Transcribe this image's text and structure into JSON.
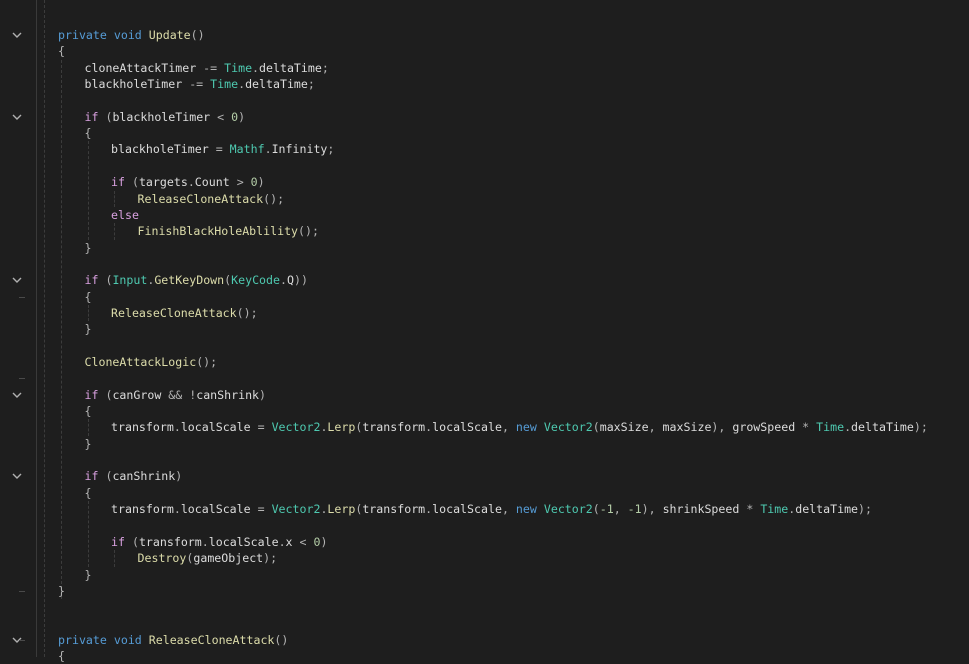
{
  "editor": {
    "theme": {
      "background": "#1e1e1e",
      "keyword": "#569cd6",
      "control_keyword": "#d8a0df",
      "type": "#4ec9b0",
      "method": "#dcdcaa",
      "identifier": "#dcdcdc",
      "number": "#b5cea8"
    },
    "fold_icon": "chevron-down-icon",
    "lines": [
      {
        "t": [
          [
            "kw",
            "private"
          ],
          [
            "id",
            " "
          ],
          [
            "kw",
            "void"
          ],
          [
            "id",
            " "
          ],
          [
            "mth",
            "Update"
          ],
          [
            "pn",
            "()"
          ]
        ]
      },
      {
        "t": [
          [
            "pn",
            "{"
          ]
        ]
      },
      {
        "t": [
          [
            "id",
            "cloneAttackTimer "
          ],
          [
            "pn",
            "-="
          ],
          [
            "id",
            " "
          ],
          [
            "typ",
            "Time"
          ],
          [
            "pn",
            "."
          ],
          [
            "id",
            "deltaTime"
          ],
          [
            "pn",
            ";"
          ]
        ]
      },
      {
        "t": [
          [
            "id",
            "blackholeTimer "
          ],
          [
            "pn",
            "-="
          ],
          [
            "id",
            " "
          ],
          [
            "typ",
            "Time"
          ],
          [
            "pn",
            "."
          ],
          [
            "id",
            "deltaTime"
          ],
          [
            "pn",
            ";"
          ]
        ]
      },
      {
        "t": []
      },
      {
        "t": [
          [
            "ctl",
            "if"
          ],
          [
            "id",
            " "
          ],
          [
            "pn",
            "("
          ],
          [
            "id",
            "blackholeTimer "
          ],
          [
            "pn",
            "<"
          ],
          [
            "id",
            " "
          ],
          [
            "num",
            "0"
          ],
          [
            "pn",
            ")"
          ]
        ]
      },
      {
        "t": [
          [
            "pn",
            "{"
          ]
        ]
      },
      {
        "t": [
          [
            "id",
            "blackholeTimer "
          ],
          [
            "pn",
            "="
          ],
          [
            "id",
            " "
          ],
          [
            "typ",
            "Mathf"
          ],
          [
            "pn",
            "."
          ],
          [
            "id",
            "Infinity"
          ],
          [
            "pn",
            ";"
          ]
        ]
      },
      {
        "t": []
      },
      {
        "t": [
          [
            "ctl",
            "if"
          ],
          [
            "id",
            " "
          ],
          [
            "pn",
            "("
          ],
          [
            "id",
            "targets"
          ],
          [
            "pn",
            "."
          ],
          [
            "id",
            "Count "
          ],
          [
            "pn",
            ">"
          ],
          [
            "id",
            " "
          ],
          [
            "num",
            "0"
          ],
          [
            "pn",
            ")"
          ]
        ]
      },
      {
        "t": [
          [
            "mth",
            "ReleaseCloneAttack"
          ],
          [
            "pn",
            "();"
          ]
        ]
      },
      {
        "t": [
          [
            "ctl",
            "else"
          ]
        ]
      },
      {
        "t": [
          [
            "mth",
            "FinishBlackHoleAblility"
          ],
          [
            "pn",
            "();"
          ]
        ]
      },
      {
        "t": [
          [
            "pn",
            "}"
          ]
        ]
      },
      {
        "t": []
      },
      {
        "t": [
          [
            "ctl",
            "if"
          ],
          [
            "id",
            " "
          ],
          [
            "pn",
            "("
          ],
          [
            "typ",
            "Input"
          ],
          [
            "pn",
            "."
          ],
          [
            "mth",
            "GetKeyDown"
          ],
          [
            "pn",
            "("
          ],
          [
            "typ",
            "KeyCode"
          ],
          [
            "pn",
            "."
          ],
          [
            "id",
            "Q"
          ],
          [
            "pn",
            "))"
          ]
        ]
      },
      {
        "t": [
          [
            "pn",
            "{"
          ]
        ]
      },
      {
        "t": [
          [
            "mth",
            "ReleaseCloneAttack"
          ],
          [
            "pn",
            "();"
          ]
        ]
      },
      {
        "t": [
          [
            "pn",
            "}"
          ]
        ]
      },
      {
        "t": []
      },
      {
        "t": [
          [
            "mth",
            "CloneAttackLogic"
          ],
          [
            "pn",
            "();"
          ]
        ]
      },
      {
        "t": []
      },
      {
        "t": [
          [
            "ctl",
            "if"
          ],
          [
            "id",
            " "
          ],
          [
            "pn",
            "("
          ],
          [
            "id",
            "canGrow "
          ],
          [
            "pn",
            "&&"
          ],
          [
            "id",
            " "
          ],
          [
            "pn",
            "!"
          ],
          [
            "id",
            "canShrink"
          ],
          [
            "pn",
            ")"
          ]
        ]
      },
      {
        "t": [
          [
            "pn",
            "{"
          ]
        ]
      },
      {
        "t": [
          [
            "id",
            "transform"
          ],
          [
            "pn",
            "."
          ],
          [
            "id",
            "localScale "
          ],
          [
            "pn",
            "="
          ],
          [
            "id",
            " "
          ],
          [
            "typ",
            "Vector2"
          ],
          [
            "pn",
            "."
          ],
          [
            "mth",
            "Lerp"
          ],
          [
            "pn",
            "("
          ],
          [
            "id",
            "transform"
          ],
          [
            "pn",
            "."
          ],
          [
            "id",
            "localScale"
          ],
          [
            "pn",
            ","
          ],
          [
            "id",
            " "
          ],
          [
            "kw",
            "new"
          ],
          [
            "id",
            " "
          ],
          [
            "typ",
            "Vector2"
          ],
          [
            "pn",
            "("
          ],
          [
            "id",
            "maxSize"
          ],
          [
            "pn",
            ","
          ],
          [
            "id",
            " maxSize"
          ],
          [
            "pn",
            "),"
          ],
          [
            "id",
            " growSpeed "
          ],
          [
            "pn",
            "*"
          ],
          [
            "id",
            " "
          ],
          [
            "typ",
            "Time"
          ],
          [
            "pn",
            "."
          ],
          [
            "id",
            "deltaTime"
          ],
          [
            "pn",
            ");"
          ]
        ]
      },
      {
        "t": [
          [
            "pn",
            "}"
          ]
        ]
      },
      {
        "t": []
      },
      {
        "t": [
          [
            "ctl",
            "if"
          ],
          [
            "id",
            " "
          ],
          [
            "pn",
            "("
          ],
          [
            "id",
            "canShrink"
          ],
          [
            "pn",
            ")"
          ]
        ]
      },
      {
        "t": [
          [
            "pn",
            "{"
          ]
        ]
      },
      {
        "t": [
          [
            "id",
            "transform"
          ],
          [
            "pn",
            "."
          ],
          [
            "id",
            "localScale "
          ],
          [
            "pn",
            "="
          ],
          [
            "id",
            " "
          ],
          [
            "typ",
            "Vector2"
          ],
          [
            "pn",
            "."
          ],
          [
            "mth",
            "Lerp"
          ],
          [
            "pn",
            "("
          ],
          [
            "id",
            "transform"
          ],
          [
            "pn",
            "."
          ],
          [
            "id",
            "localScale"
          ],
          [
            "pn",
            ","
          ],
          [
            "id",
            " "
          ],
          [
            "kw",
            "new"
          ],
          [
            "id",
            " "
          ],
          [
            "typ",
            "Vector2"
          ],
          [
            "pn",
            "("
          ],
          [
            "num",
            "-1"
          ],
          [
            "pn",
            ","
          ],
          [
            "id",
            " "
          ],
          [
            "num",
            "-1"
          ],
          [
            "pn",
            "),"
          ],
          [
            "id",
            " shrinkSpeed "
          ],
          [
            "pn",
            "*"
          ],
          [
            "id",
            " "
          ],
          [
            "typ",
            "Time"
          ],
          [
            "pn",
            "."
          ],
          [
            "id",
            "deltaTime"
          ],
          [
            "pn",
            ");"
          ]
        ]
      },
      {
        "t": []
      },
      {
        "t": [
          [
            "ctl",
            "if"
          ],
          [
            "id",
            " "
          ],
          [
            "pn",
            "("
          ],
          [
            "id",
            "transform"
          ],
          [
            "pn",
            "."
          ],
          [
            "id",
            "localScale"
          ],
          [
            "pn",
            "."
          ],
          [
            "id",
            "x "
          ],
          [
            "pn",
            "<"
          ],
          [
            "id",
            " "
          ],
          [
            "num",
            "0"
          ],
          [
            "pn",
            ")"
          ]
        ]
      },
      {
        "t": [
          [
            "mth",
            "Destroy"
          ],
          [
            "pn",
            "("
          ],
          [
            "id",
            "gameObject"
          ],
          [
            "pn",
            ");"
          ]
        ]
      },
      {
        "t": [
          [
            "pn",
            "}"
          ]
        ]
      },
      {
        "t": [
          [
            "pn",
            "}"
          ]
        ]
      },
      {
        "t": []
      },
      {
        "t": []
      },
      {
        "t": [
          [
            "kw",
            "private"
          ],
          [
            "id",
            " "
          ],
          [
            "kw",
            "void"
          ],
          [
            "id",
            " "
          ],
          [
            "mth",
            "ReleaseCloneAttack"
          ],
          [
            "pn",
            "()"
          ]
        ]
      },
      {
        "t": [
          [
            "pn",
            "{"
          ]
        ]
      }
    ]
  }
}
